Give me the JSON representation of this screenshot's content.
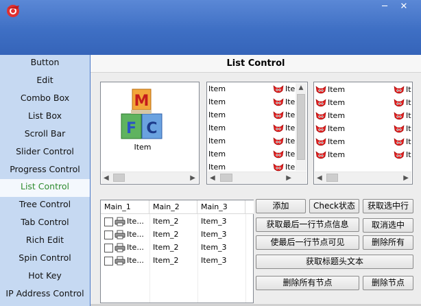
{
  "window": {
    "icon": "app-logo-icon",
    "minimize_glyph": "─",
    "close_glyph": "✕"
  },
  "sidebar": {
    "items": [
      {
        "label": "Button"
      },
      {
        "label": "Edit"
      },
      {
        "label": "Combo Box"
      },
      {
        "label": "List Box"
      },
      {
        "label": "Scroll Bar"
      },
      {
        "label": "Slider Control"
      },
      {
        "label": "Progress Control"
      },
      {
        "label": "List Control",
        "active": true
      },
      {
        "label": "Tree Control"
      },
      {
        "label": "Tab Control"
      },
      {
        "label": "Rich Edit"
      },
      {
        "label": "Spin Control"
      },
      {
        "label": "Hot Key"
      },
      {
        "label": "IP Address Control"
      }
    ]
  },
  "main": {
    "title": "List Control",
    "icon_view": {
      "icon": "mfc-blocks-icon",
      "item_label": "Item"
    },
    "small_icon_list": {
      "col1": [
        "Item",
        "Item",
        "Item",
        "Item",
        "Item",
        "Item",
        "Item"
      ],
      "col2": [
        "Ite",
        "Ite",
        "Ite",
        "Ite",
        "Ite",
        "Ite",
        "Ite"
      ]
    },
    "list_view": {
      "col1": [
        "Item",
        "Item",
        "Item",
        "Item",
        "Item",
        "Item"
      ],
      "col2": [
        "It",
        "It",
        "It",
        "It",
        "It",
        "It"
      ]
    },
    "report": {
      "headers": [
        "Main_1",
        "Main_2",
        "Main_3"
      ],
      "rows": [
        [
          "Ite...",
          "Item_2",
          "Item_3"
        ],
        [
          "Ite...",
          "Item_2",
          "Item_3"
        ],
        [
          "Ite...",
          "Item_2",
          "Item_3"
        ],
        [
          "Ite...",
          "Item_2",
          "Item_3"
        ]
      ]
    },
    "buttons": {
      "add": "添加",
      "check_state": "Check状态",
      "get_selected": "获取选中行",
      "get_last_row_info": "获取最后一行节点信息",
      "deselect": "取消选中",
      "make_last_visible": "使最后一行节点可见",
      "delete_all": "删除所有",
      "get_header_text": "获取标题头文本",
      "delete_all_nodes": "删除所有节点",
      "delete_node": "删除节点"
    }
  }
}
